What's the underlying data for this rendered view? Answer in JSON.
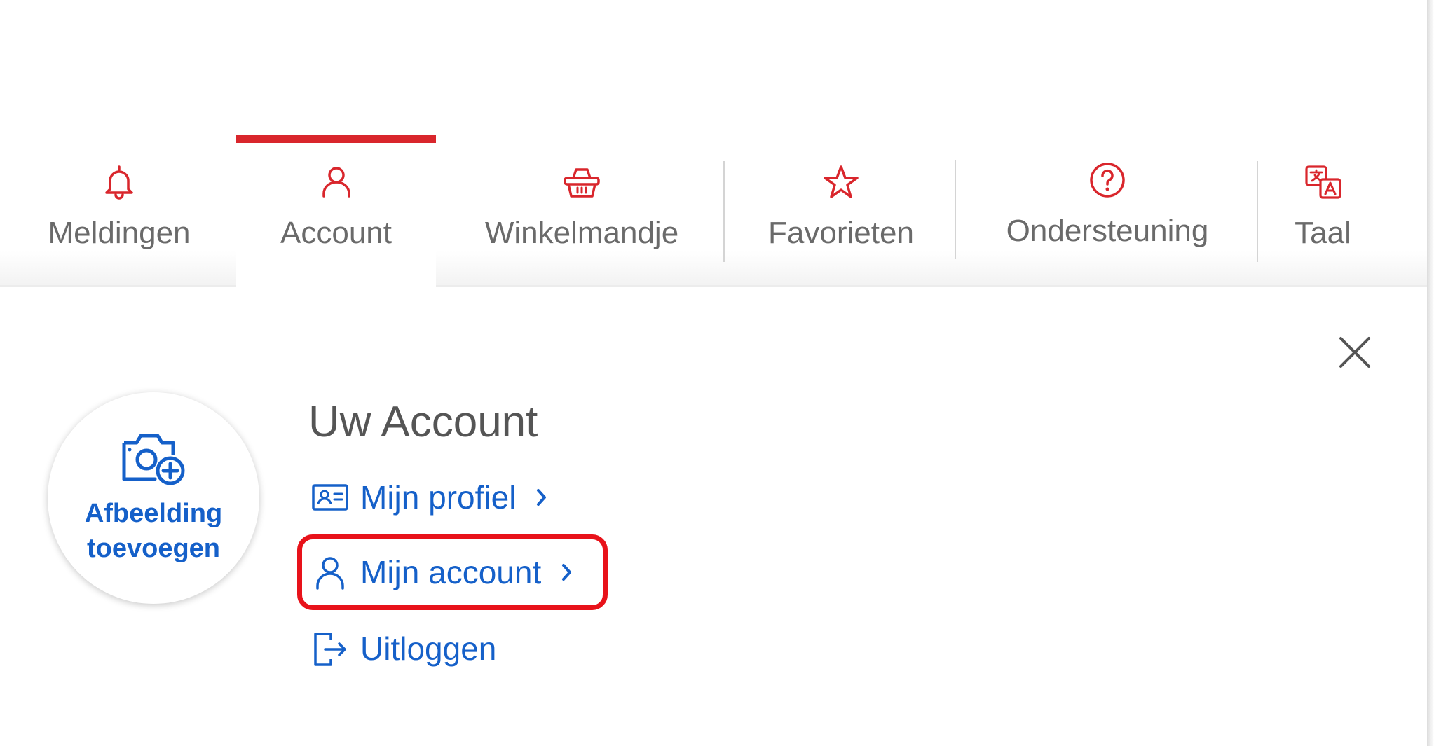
{
  "tabs": [
    {
      "label": "Meldingen",
      "icon": "bell-icon"
    },
    {
      "label": "Account",
      "icon": "user-icon",
      "active": true
    },
    {
      "label": "Winkelmandje",
      "icon": "basket-icon"
    },
    {
      "label": "Favorieten",
      "icon": "star-icon"
    },
    {
      "label": "Ondersteuning",
      "icon": "help-icon"
    },
    {
      "label": "Taal",
      "icon": "language-icon"
    }
  ],
  "avatar": {
    "label_line1": "Afbeelding",
    "label_line2": "toevoegen",
    "icon": "camera-add-icon"
  },
  "account": {
    "title": "Uw Account",
    "links": [
      {
        "label": "Mijn profiel",
        "icon": "profile-card-icon",
        "chevron": true
      },
      {
        "label": "Mijn account",
        "icon": "user-icon",
        "chevron": true,
        "highlighted": true
      },
      {
        "label": "Uitloggen",
        "icon": "logout-icon",
        "chevron": false
      }
    ]
  },
  "colors": {
    "accent_red": "#d9262c",
    "link_blue": "#1560c9",
    "highlight_red": "#e8121a",
    "tab_text": "#6a6a6a"
  }
}
